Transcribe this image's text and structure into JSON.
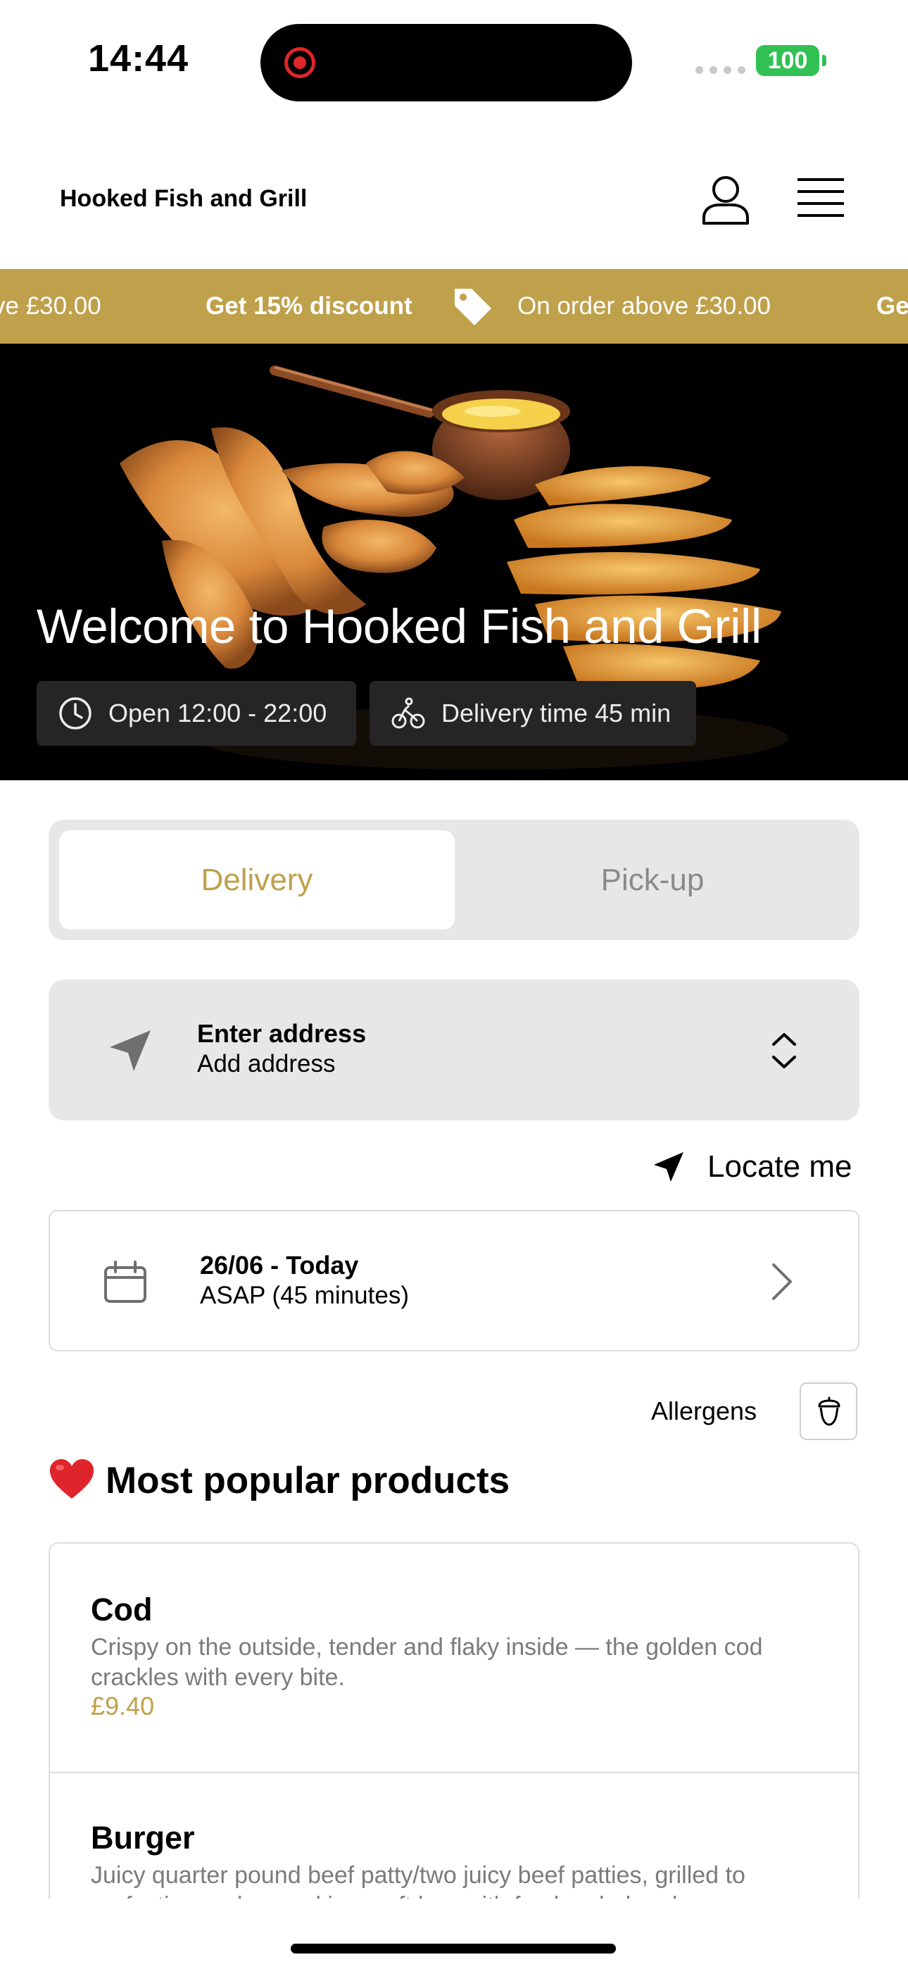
{
  "status_bar": {
    "time": "14:44",
    "battery": "100"
  },
  "header": {
    "brand": "Hooked Fish and Grill",
    "icons": [
      "user-icon",
      "menu-icon"
    ]
  },
  "promo": {
    "items": [
      {
        "text": "ve £30.00",
        "bold": false
      },
      {
        "text": "Get 15% discount",
        "bold": true
      },
      {
        "text": "On order above £30.00",
        "bold": false
      },
      {
        "text": "Ge",
        "bold": true
      }
    ]
  },
  "hero": {
    "title": "Welcome to Hooked Fish and Grill",
    "open_hours": "Open 12:00 - 22:00",
    "delivery_time": "Delivery time 45 min"
  },
  "mode": {
    "options": [
      "Delivery",
      "Pick-up"
    ],
    "selected": "Delivery"
  },
  "address": {
    "title": "Enter address",
    "subtitle": "Add address"
  },
  "locate": {
    "label": "Locate me"
  },
  "schedule": {
    "date": "26/06 - Today",
    "time": "ASAP (45 minutes)"
  },
  "allergens": {
    "label": "Allergens"
  },
  "popular": {
    "title": "Most popular products",
    "products": [
      {
        "name": "Cod",
        "description": "Crispy on the outside, tender and flaky inside — the golden cod crackles with every bite.",
        "price": "£9.40"
      },
      {
        "name": "Burger",
        "description": "Juicy quarter pound beef patty/two juicy beef patties, grilled to perfection and served in a soft bun with fresh salad and a"
      }
    ]
  },
  "colors": {
    "accent": "#bfa04b",
    "chip_bg": "#252525",
    "panel_bg": "#e7e7e7",
    "battery": "#30c152",
    "record": "#e0252b"
  }
}
